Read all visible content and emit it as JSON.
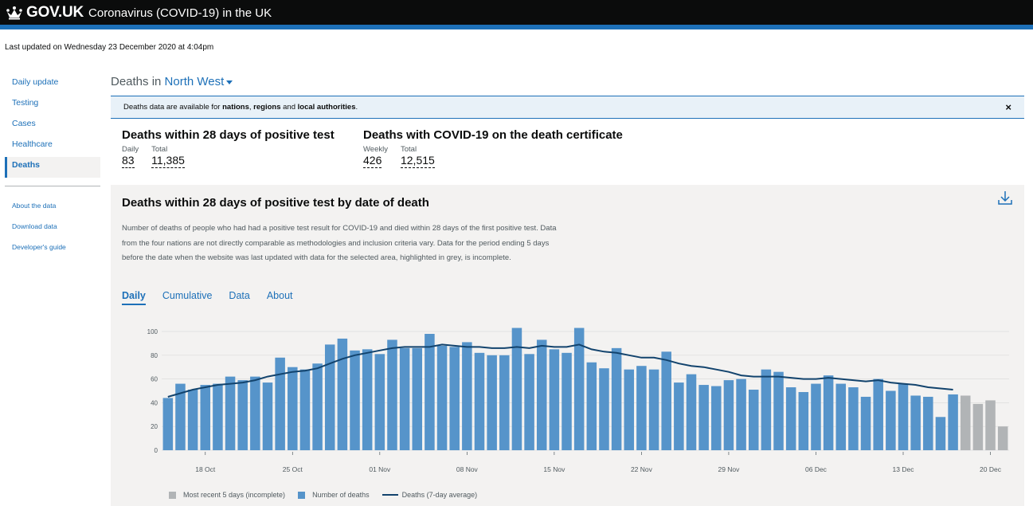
{
  "header": {
    "logo": "GOV.UK",
    "title": "Coronavirus (COVID-19) in the UK",
    "colors": {
      "bar": "#0b0c0c",
      "accent": "#1d70b8"
    }
  },
  "last_updated": "Last updated on Wednesday 23 December 2020 at 4:04pm",
  "sidebar": {
    "items": [
      {
        "label": "Daily update"
      },
      {
        "label": "Testing"
      },
      {
        "label": "Cases"
      },
      {
        "label": "Healthcare"
      },
      {
        "label": "Deaths",
        "active": true
      }
    ],
    "secondary": [
      {
        "label": "About the data"
      },
      {
        "label": "Download data"
      },
      {
        "label": "Developer's guide"
      }
    ]
  },
  "page": {
    "heading_prefix": "Deaths in",
    "region": "North West"
  },
  "notice": {
    "t1": "Deaths data are available for ",
    "l1": "nations",
    "t2": ", ",
    "l2": "regions",
    "t3": " and ",
    "l3": "local authorities",
    "t4": ".",
    "close": "×"
  },
  "headlines": [
    {
      "title": "Deaths within 28 days of positive test",
      "metrics": [
        {
          "label": "Daily",
          "value": "83"
        },
        {
          "label": "Total",
          "value": "11,385"
        }
      ]
    },
    {
      "title": "Deaths with COVID-19 on the death certificate",
      "metrics": [
        {
          "label": "Weekly",
          "value": "426"
        },
        {
          "label": "Total",
          "value": "12,515"
        }
      ]
    }
  ],
  "card": {
    "title": "Deaths within 28 days of positive test by date of death",
    "description": "Number of deaths of people who had had a positive test result for COVID-19 and died within 28 days of the first positive test. Data from the four nations are not directly comparable as methodologies and inclusion criteria vary. Data for the period ending 5 days before the date when the website was last updated with data for the selected area, highlighted in grey, is incomplete.",
    "tabs": [
      {
        "label": "Daily",
        "active": true
      },
      {
        "label": "Cumulative"
      },
      {
        "label": "Data"
      },
      {
        "label": "About"
      }
    ]
  },
  "chart_data": {
    "type": "bar",
    "ylim": [
      0,
      100
    ],
    "yticks": [
      0,
      20,
      40,
      60,
      80,
      100
    ],
    "x_start": "2020-10-15",
    "xtick_labels": [
      "18 Oct",
      "25 Oct",
      "01 Nov",
      "08 Nov",
      "15 Nov",
      "22 Nov",
      "29 Nov",
      "06 Dec",
      "13 Dec",
      "20 Dec"
    ],
    "xtick_indices": [
      3,
      10,
      17,
      24,
      31,
      38,
      45,
      52,
      59,
      66
    ],
    "values": [
      44,
      56,
      51,
      55,
      56,
      62,
      59,
      62,
      57,
      78,
      70,
      68,
      73,
      89,
      94,
      84,
      85,
      81,
      93,
      86,
      86,
      98,
      88,
      87,
      91,
      82,
      80,
      80,
      103,
      81,
      93,
      85,
      82,
      103,
      74,
      69,
      86,
      68,
      71,
      68,
      83,
      57,
      64,
      55,
      54,
      59,
      60,
      51,
      68,
      66,
      53,
      49,
      56,
      63,
      56,
      53,
      45,
      60,
      50,
      56,
      46,
      45,
      28,
      47,
      46,
      39,
      42,
      20
    ],
    "incomplete_from_index": 64,
    "avg": [
      45,
      48,
      51,
      53,
      55,
      56,
      57,
      59,
      62,
      64,
      66,
      67,
      69,
      73,
      77,
      80,
      82,
      84,
      86,
      87,
      87,
      87,
      89,
      88,
      87,
      87,
      86,
      86,
      87,
      86,
      88,
      87,
      87,
      89,
      85,
      83,
      82,
      80,
      78,
      78,
      76,
      73,
      71,
      70,
      68,
      66,
      63,
      62,
      62,
      62,
      61,
      60,
      60,
      61,
      60,
      59,
      58,
      59,
      57,
      56,
      55,
      53,
      52,
      51,
      50,
      47,
      46,
      45
    ],
    "avg_visible_until_index": 63,
    "legend": [
      {
        "label": "Most recent 5 days (incomplete)",
        "color": "#b1b4b6",
        "kind": "bar"
      },
      {
        "label": "Number of deaths",
        "color": "#5694ca",
        "kind": "bar"
      },
      {
        "label": "Deaths (7-day average)",
        "color": "#12436d",
        "kind": "line"
      }
    ]
  }
}
